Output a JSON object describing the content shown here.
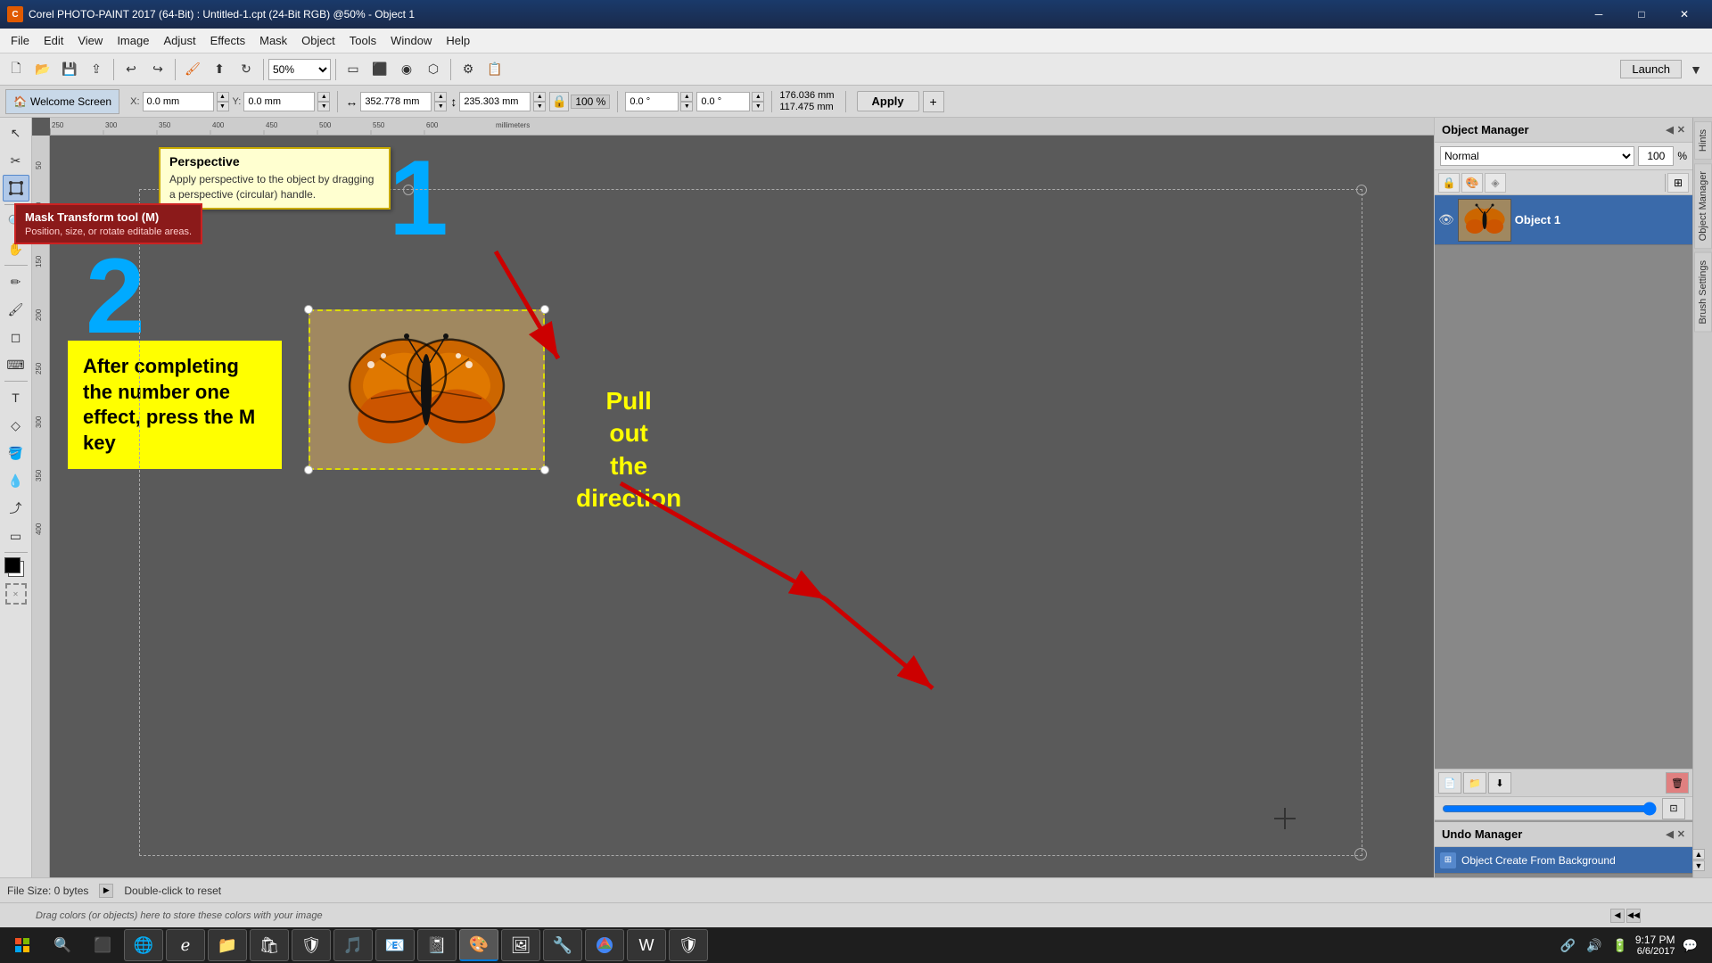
{
  "titlebar": {
    "title": "Corel PHOTO-PAINT 2017 (64-Bit) : Untitled-1.cpt (24-Bit RGB) @50% - Object 1",
    "controls": [
      "─",
      "□",
      "✕"
    ]
  },
  "menubar": {
    "items": [
      "File",
      "Edit",
      "View",
      "Image",
      "Adjust",
      "Effects",
      "Mask",
      "Object",
      "Tools",
      "Window",
      "Help"
    ]
  },
  "toolbar": {
    "launch_label": "Launch",
    "apply_label": "Apply"
  },
  "tool_options": {
    "x_label": "X:",
    "x_value": "0.0 mm",
    "y_label": "Y:",
    "y_value": "0.0 mm",
    "width_label": "",
    "width_value": "352.778 mm",
    "height_value": "235.303 mm",
    "zoom_value": "50%",
    "angle_value": "0.0 °",
    "angle2_value": "0.0 °",
    "dim1_value": "176.036 mm",
    "dim2_value": "117.475 mm",
    "apply_btn": "Apply"
  },
  "breadcrumb": {
    "label": "Welcome Screen"
  },
  "tooltip_perspective": {
    "title": "Perspective",
    "description": "Apply perspective to the object by dragging a perspective (circular) handle."
  },
  "tooltip_mask_transform": {
    "title": "Mask Transform tool (M)",
    "description": "Position, size, or rotate editable areas."
  },
  "canvas": {
    "number1": "1",
    "number2": "2",
    "yellow_box_text": "After completing the number one effect, press the M key",
    "pullout_text": "Pull\nout\nthe\ndirection",
    "butterfly_label": "Object 1"
  },
  "object_manager": {
    "title": "Object Manager",
    "blend_mode": "Normal",
    "opacity_value": "100",
    "opacity_unit": "%",
    "objects": [
      {
        "id": 1,
        "name": "Object 1",
        "selected": true
      }
    ],
    "undo_title": "Undo Manager",
    "undo_items": [
      {
        "label": "Object Create From Background",
        "selected": true
      }
    ]
  },
  "statusbar": {
    "file_size": "File Size: 0 bytes",
    "hint": "Double-click to reset"
  },
  "colorbar": {
    "hint": "Drag colors (or objects) here to store these colors with your image"
  },
  "taskbar": {
    "time": "9:17 PM",
    "date": "6/6/2017"
  },
  "side_tabs": [
    "Hints",
    "Object Manager",
    "Brush Settings"
  ]
}
